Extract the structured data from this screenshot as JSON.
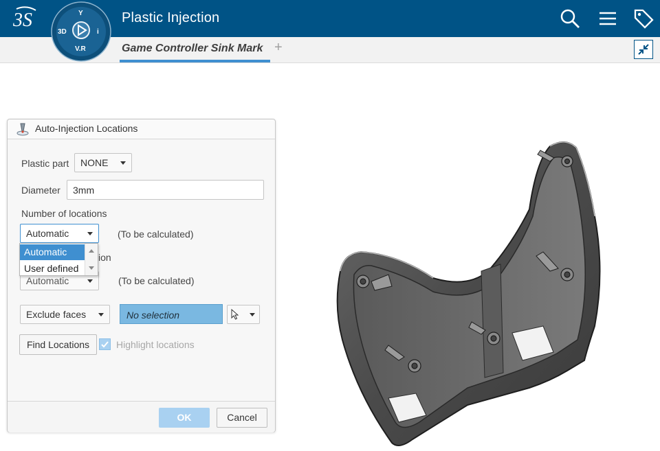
{
  "app": {
    "title": "Plastic Injection",
    "compass": {
      "top": "Y",
      "left": "3D",
      "right": "i",
      "bottom": "V.R"
    }
  },
  "topbar": {
    "icons": [
      "search-icon",
      "menu-icon",
      "tag-icon"
    ]
  },
  "tabs": [
    {
      "label": "Game Controller Sink Mark",
      "active": true
    }
  ],
  "tab_add_label": "+",
  "colors": {
    "topbar": "#005386",
    "accent": "#3f8fd0",
    "selection": "#7ab8e1",
    "ok_disabled": "#a9d1f1"
  },
  "dialog": {
    "title": "Auto-Injection Locations",
    "plastic_part": {
      "label": "Plastic part",
      "value": "NONE"
    },
    "diameter": {
      "label": "Diameter",
      "value": "3mm"
    },
    "number_of_locations": {
      "label": "Number of locations",
      "value": "Automatic",
      "status": "(To be calculated)",
      "options": [
        "Automatic",
        "User defined"
      ],
      "hidden_label_tail": "ion"
    },
    "second_row": {
      "value": "Automatic",
      "status": "(To be calculated)"
    },
    "exclude": {
      "label": "Exclude faces",
      "selection": "No selection"
    },
    "find_label": "Find Locations",
    "highlight": {
      "label": "Highlight locations",
      "checked": true
    },
    "ok_label": "OK",
    "cancel_label": "Cancel"
  }
}
